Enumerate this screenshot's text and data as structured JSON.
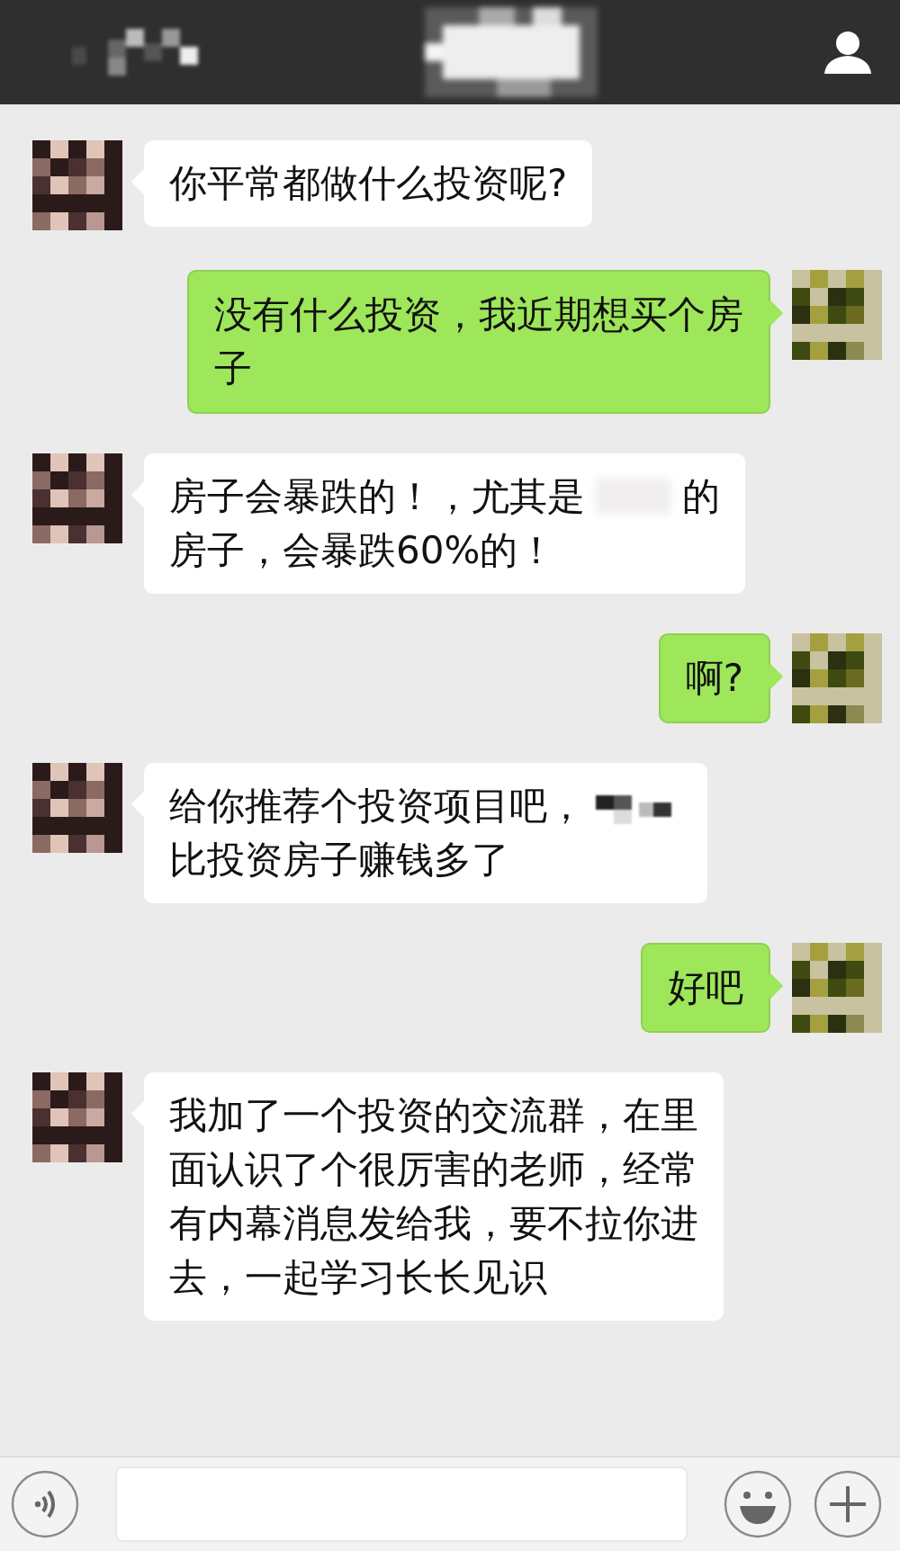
{
  "messages": [
    {
      "kind": "incoming",
      "lines": [
        [
          {
            "kind": "text",
            "text": "你平常都做什么投资呢?"
          }
        ]
      ]
    },
    {
      "kind": "outgoing",
      "lines": [
        [
          {
            "kind": "text",
            "text": "没有什么投资，我近期想买个房"
          }
        ],
        [
          {
            "kind": "text",
            "text": "子"
          }
        ]
      ]
    },
    {
      "kind": "incoming",
      "lines": [
        [
          {
            "kind": "text",
            "text": "房子会暴跌的！，尤其是"
          },
          {
            "kind": "redacted"
          },
          {
            "kind": "text",
            "text": "的"
          }
        ],
        [
          {
            "kind": "text",
            "text": "房子，会暴跌60%的！"
          }
        ]
      ]
    },
    {
      "kind": "outgoing",
      "lines": [
        [
          {
            "kind": "text",
            "text": "啊?"
          }
        ]
      ]
    },
    {
      "kind": "incoming",
      "lines": [
        [
          {
            "kind": "text",
            "text": "给你推荐个投资项目吧，"
          },
          {
            "kind": "redacted"
          }
        ],
        [
          {
            "kind": "text",
            "text": "比投资房子赚钱多了"
          }
        ]
      ]
    },
    {
      "kind": "outgoing",
      "lines": [
        [
          {
            "kind": "text",
            "text": "好吧"
          }
        ]
      ]
    },
    {
      "kind": "incoming",
      "lines": [
        [
          {
            "kind": "text",
            "text": "我加了一个投资的交流群，在里"
          }
        ],
        [
          {
            "kind": "text",
            "text": "面认识了个很厉害的老师，经常"
          }
        ],
        [
          {
            "kind": "text",
            "text": "有内幕消息发给我，要不拉你进"
          }
        ],
        [
          {
            "kind": "text",
            "text": "去，一起学习长长见识"
          }
        ]
      ]
    }
  ]
}
